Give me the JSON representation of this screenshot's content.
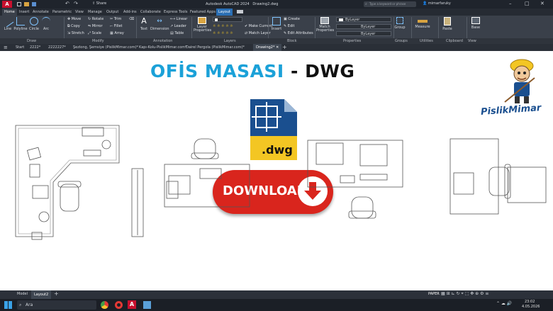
{
  "window": {
    "app_title": "Autodesk AutoCAD 2024",
    "file": "Drawing2.dwg",
    "search_placeholder": "Type a keyword or phrase",
    "user": "mimarfaruky",
    "share": "Share"
  },
  "ribbon_tabs": [
    "Home",
    "Insert",
    "Annotate",
    "Parametric",
    "View",
    "Manage",
    "Output",
    "Add-ins",
    "Collaborate",
    "Express Tools",
    "Featured Apps",
    "Layout"
  ],
  "active_ribbon_tab": "Home",
  "draw_tools": [
    "Line",
    "Polyline",
    "Circle",
    "Arc"
  ],
  "modify_tools": [
    "Move",
    "Rotate",
    "Trim",
    "Copy",
    "Mirror",
    "Fillet",
    "Stretch",
    "Scale",
    "Array"
  ],
  "annotation_tools": [
    "Text",
    "Dimension",
    "Linear",
    "Leader",
    "Table"
  ],
  "layer_tools": [
    "Layer Properties",
    "Make Current",
    "Match Layer"
  ],
  "block_tools": [
    "Insert",
    "Create",
    "Edit",
    "Edit Attributes"
  ],
  "properties": {
    "match_label": "Match Properties",
    "color": "ByLayer",
    "linetype": "ByLayer",
    "lineweight": "ByLayer"
  },
  "other_tools": [
    "Group",
    "Measure",
    "Paste",
    "Base"
  ],
  "panel_labels": [
    "Draw",
    "Modify",
    "Annotation",
    "Layers",
    "Block",
    "Properties",
    "Groups",
    "Utilities",
    "Clipboard",
    "View"
  ],
  "doc_tabs": [
    "Start",
    "2222*",
    "2222227*",
    "Şezlong, Şemsiye (PislikMimar.com)*",
    "Kapı-Kolu-PislikMimar.com*",
    "Dairel Pergola (PislikMimar.com)*",
    "Drawing2*"
  ],
  "active_doc_tab": "Drawing2*",
  "canvas": {
    "title_part1": "OFİS MASASI",
    "title_dash": "-",
    "title_part2": "DWG",
    "file_icon_label": ".dwg",
    "download_label": "DOWNLOAD",
    "logo_text": "PislikMimar"
  },
  "layout_tabs": [
    "Model",
    "Layout2"
  ],
  "active_layout_tab": "Layout2",
  "status": {
    "paper": "PAPER"
  },
  "taskbar": {
    "search_placeholder": "Ara",
    "time": "23:02",
    "date": "4.05.2026"
  },
  "colors": {
    "title_blue": "#1ba1d8",
    "title_black": "#111111",
    "download_red": "#d9251d",
    "dwg_blue": "#1a4f8f",
    "dwg_yellow": "#f3c623",
    "autocad_red": "#c8102e"
  }
}
